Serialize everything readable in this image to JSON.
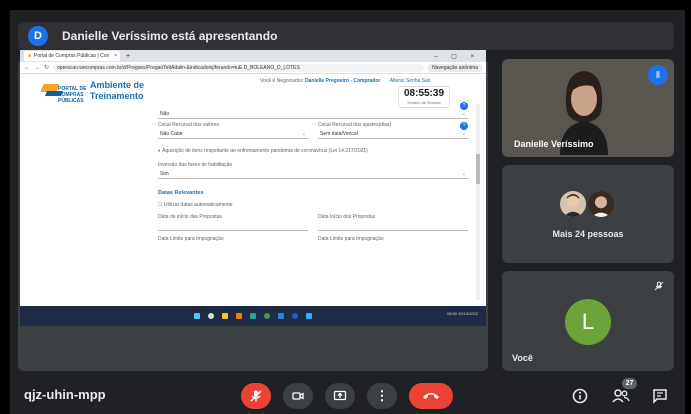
{
  "presenting": {
    "avatar_letter": "D",
    "text": "Danielle Veríssimo está apresentando"
  },
  "shared_screen": {
    "tab_title": "Portal de Compras Públicas | Con",
    "url": "operacao.wecompras.com.br/d/Pregoes/PregaoTeltAdalin-&indicadoinj/ferando=tuE D_BOLEANO_D_LOTES",
    "incognito_label": "Navegação anônima",
    "logo_text": "PORTAL DE COMPRAS PÚBLICAS",
    "env_title": "Ambiente de Treinamento",
    "user_line_prefix": "Você é Negociador:",
    "user_name": "Danielle Pregoeiro - Comprador",
    "user_links": "Alterar Senha   Sair",
    "clock": "08:55:39",
    "clock_sub": "Horário de Brasília",
    "fields": {
      "value_top": "Não",
      "label_recurso": "Cocal Recursal dos valores",
      "value_recurso": "Não Cabe",
      "label_ajustes": "Cocal Recursal dos ajustes(dias)",
      "value_ajustes": "Sem data/Vencal",
      "aquisicao_label": "Aquisição de itens respeitante ao enfrentamento pandemia de coronavírus (Lei 14.217/2021)",
      "label_inversao": "Inversão das fases de habilitação",
      "value_inversao": "Sim",
      "section_datas": "Datas Relevantes",
      "check_label": "Utilizar datas automaticamente",
      "label_inicio_acolhimento": "Data de início das Propostas",
      "label_inicio_pregao": "Data Início dos Propostas",
      "label_limite_impugnacao": "Data Limite para Impugnação",
      "label_limite_esclarecimento": "Data Limite para Impugnação"
    },
    "taskbar_time": "08:55 10/10/2022"
  },
  "participants": {
    "self_name": "Danielle Veríssimo",
    "more_label": "Mais 24 pessoas",
    "you_initial": "L",
    "you_name": "Você"
  },
  "bottom_bar": {
    "meeting_code": "qjz-uhin-mpp",
    "people_count": "27"
  },
  "colors": {
    "leave_red": "#ea4335",
    "mic_red": "#ea4335",
    "speaking_blue": "#1a73e8",
    "you_avatar_green": "#6ba539"
  }
}
